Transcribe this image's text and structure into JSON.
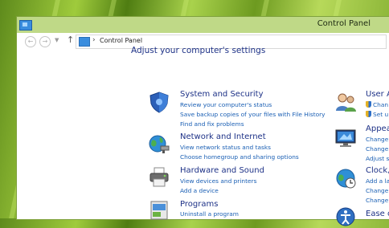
{
  "window": {
    "title": "Control Panel"
  },
  "address_bar": {
    "path": "Control Panel"
  },
  "main": {
    "heading": "Adjust your computer's settings",
    "categories_left": [
      {
        "title": "System and Security",
        "icon": "shield-icon",
        "links": [
          "Review your computer's status",
          "Save backup copies of your files with File History",
          "Find and fix problems"
        ]
      },
      {
        "title": "Network and Internet",
        "icon": "globe-network-icon",
        "links": [
          "View network status and tasks",
          "Choose homegroup and sharing options"
        ]
      },
      {
        "title": "Hardware and Sound",
        "icon": "printer-icon",
        "links": [
          "View devices and printers",
          "Add a device"
        ]
      },
      {
        "title": "Programs",
        "icon": "programs-icon",
        "links": [
          "Uninstall a program"
        ]
      }
    ],
    "categories_right": [
      {
        "title": "User A",
        "icon": "users-icon",
        "links": [
          "Chan",
          "Set u"
        ]
      },
      {
        "title": "Appea",
        "icon": "monitor-icon",
        "links": [
          "Change",
          "Change",
          "Adjust s"
        ]
      },
      {
        "title": "Clock,",
        "icon": "clock-globe-icon",
        "links": [
          "Add a la",
          "Change",
          "Change"
        ]
      },
      {
        "title": "Ease o",
        "icon": "ease-of-access-icon",
        "links": []
      }
    ]
  },
  "colors": {
    "heading": "#1e3287",
    "link": "#1a5fb4",
    "frame": "#bfd987"
  }
}
